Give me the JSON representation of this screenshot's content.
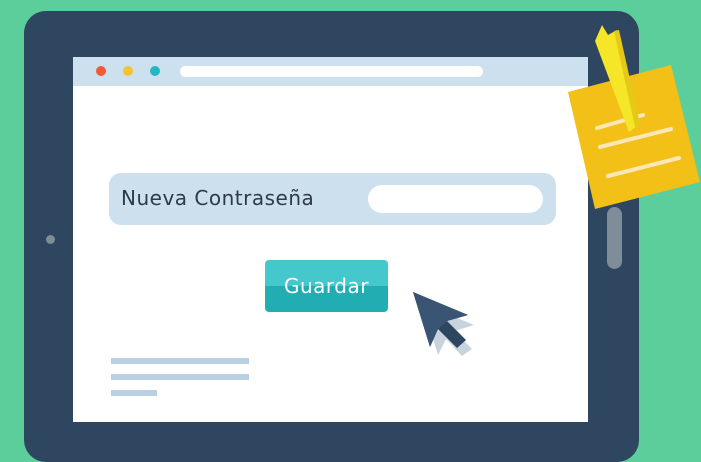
{
  "colors": {
    "background": "#5cce9b",
    "tablet_frame": "#2e4660",
    "browser_bar": "#cde0ee",
    "accent_button": "#22adb3",
    "sticky_note": "#f3c018",
    "window_dot_close": "#f05a37",
    "window_dot_minimize": "#f7c331",
    "window_dot_maximize": "#22b8c3"
  },
  "form": {
    "password_label": "Nueva Contraseña",
    "password_value": "",
    "save_label": "Guardar"
  },
  "icons": {
    "cursor": "mouse-pointer-icon",
    "note": "sticky-note-icon"
  }
}
